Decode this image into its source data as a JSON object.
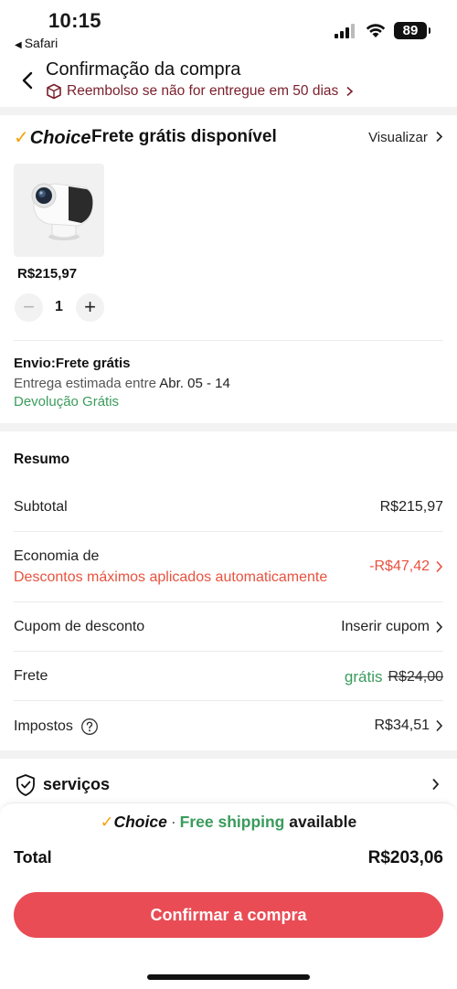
{
  "status_bar": {
    "time": "10:15",
    "back_app": "Safari",
    "battery": "89"
  },
  "header": {
    "title": "Confirmação da compra",
    "subtitle": "Reembolso se não for entregue em 50 dias"
  },
  "store": {
    "choice_logo": "Choice",
    "free_shipping": "Frete grátis disponível",
    "view_link": "Visualizar"
  },
  "product": {
    "price": "R$215,97",
    "quantity": "1"
  },
  "shipping": {
    "label": "Envio:Frete grátis",
    "estimate_prefix": "Entrega estimada entre ",
    "estimate_dates": "Abr. 05 - 14",
    "returns": "Devolução Grátis"
  },
  "summary": {
    "title": "Resumo",
    "subtotal_label": "Subtotal",
    "subtotal_value": "R$215,97",
    "savings_label": "Economia de",
    "savings_note": "Descontos máximos aplicados automaticamente",
    "savings_value": "-R$47,42",
    "coupon_label": "Cupom de desconto",
    "coupon_value": "Inserir cupom",
    "shipping_label": "Frete",
    "shipping_free": "grátis",
    "shipping_original": "R$24,00",
    "taxes_label": "Impostos",
    "taxes_value": "R$34,51"
  },
  "services": {
    "label": "serviços"
  },
  "promo": {
    "choice": "Choice",
    "separator": "·",
    "free_shipping": "Free shipping",
    "available": "available"
  },
  "footer": {
    "total_label": "Total",
    "total_value": "R$203,06",
    "confirm_button": "Confirmar a compra"
  },
  "colors": {
    "accent_red": "#e94c55",
    "discount_red": "#e8523f",
    "green": "#3a9b5c",
    "refund_text": "#7a1e2b",
    "choice_check": "#f3a10b"
  }
}
